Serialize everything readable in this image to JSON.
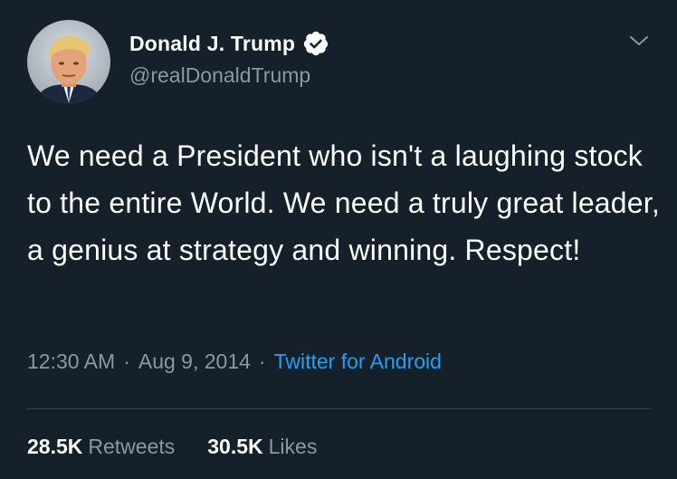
{
  "tweet": {
    "author": {
      "display_name": "Donald J. Trump",
      "handle": "@realDonaldTrump",
      "verified": true,
      "avatar_icon": "profile-photo"
    },
    "text": "We need a President who isn't a laughing stock to the entire World. We need a truly great leader, a genius at strategy and winning. Respect!",
    "time": "12:30 AM",
    "separator": "·",
    "date": "Aug 9, 2014",
    "source": "Twitter for Android",
    "stats": {
      "retweets_count": "28.5K",
      "retweets_label": "Retweets",
      "likes_count": "30.5K",
      "likes_label": "Likes"
    },
    "menu_icon": "chevron-down-icon"
  },
  "colors": {
    "background": "#15202b",
    "text_primary": "#ffffff",
    "text_secondary": "#8899a6",
    "link": "#1da1f2",
    "divider": "#38444d"
  }
}
